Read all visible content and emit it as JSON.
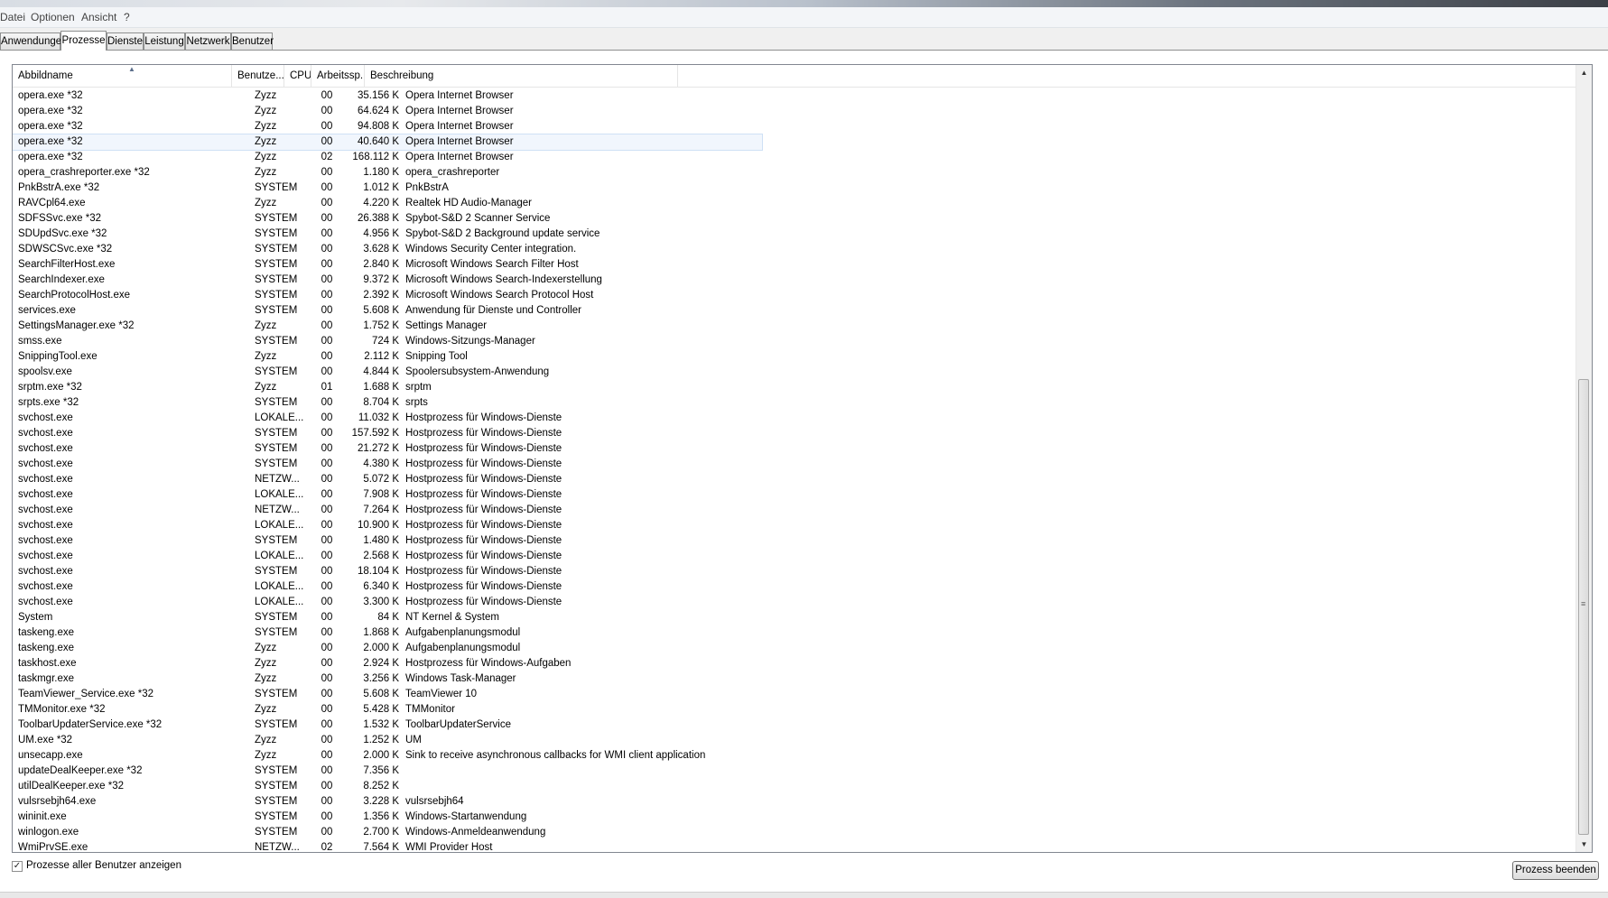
{
  "menu": [
    "Datei",
    "Optionen",
    "Ansicht",
    "?"
  ],
  "tabs": [
    "Anwendungen",
    "Prozesse",
    "Dienste",
    "Leistung",
    "Netzwerk",
    "Benutzer"
  ],
  "active_tab": "Prozesse",
  "columns": [
    "Abbildname",
    "Benutze...",
    "CPU",
    "Arbeitssp...",
    "Beschreibung"
  ],
  "processes": [
    [
      "opera.exe *32",
      "Zyzz",
      "00",
      "35.156 K",
      "Opera Internet Browser"
    ],
    [
      "opera.exe *32",
      "Zyzz",
      "00",
      "64.624 K",
      "Opera Internet Browser"
    ],
    [
      "opera.exe *32",
      "Zyzz",
      "00",
      "94.808 K",
      "Opera Internet Browser"
    ],
    [
      "opera.exe *32",
      "Zyzz",
      "00",
      "40.640 K",
      "Opera Internet Browser"
    ],
    [
      "opera.exe *32",
      "Zyzz",
      "02",
      "168.112 K",
      "Opera Internet Browser"
    ],
    [
      "opera_crashreporter.exe *32",
      "Zyzz",
      "00",
      "1.180 K",
      "opera_crashreporter"
    ],
    [
      "PnkBstrA.exe *32",
      "SYSTEM",
      "00",
      "1.012 K",
      "PnkBstrA"
    ],
    [
      "RAVCpl64.exe",
      "Zyzz",
      "00",
      "4.220 K",
      "Realtek HD Audio-Manager"
    ],
    [
      "SDFSSvc.exe *32",
      "SYSTEM",
      "00",
      "26.388 K",
      "Spybot-S&D 2 Scanner Service"
    ],
    [
      "SDUpdSvc.exe *32",
      "SYSTEM",
      "00",
      "4.956 K",
      "Spybot-S&D 2 Background update service"
    ],
    [
      "SDWSCSvc.exe *32",
      "SYSTEM",
      "00",
      "3.628 K",
      "Windows Security Center integration."
    ],
    [
      "SearchFilterHost.exe",
      "SYSTEM",
      "00",
      "2.840 K",
      "Microsoft Windows Search Filter Host"
    ],
    [
      "SearchIndexer.exe",
      "SYSTEM",
      "00",
      "9.372 K",
      "Microsoft Windows Search-Indexerstellung"
    ],
    [
      "SearchProtocolHost.exe",
      "SYSTEM",
      "00",
      "2.392 K",
      "Microsoft Windows Search Protocol Host"
    ],
    [
      "services.exe",
      "SYSTEM",
      "00",
      "5.608 K",
      "Anwendung für Dienste und Controller"
    ],
    [
      "SettingsManager.exe *32",
      "Zyzz",
      "00",
      "1.752 K",
      "Settings Manager"
    ],
    [
      "smss.exe",
      "SYSTEM",
      "00",
      "724 K",
      "Windows-Sitzungs-Manager"
    ],
    [
      "SnippingTool.exe",
      "Zyzz",
      "00",
      "2.112 K",
      "Snipping Tool"
    ],
    [
      "spoolsv.exe",
      "SYSTEM",
      "00",
      "4.844 K",
      "Spoolersubsystem-Anwendung"
    ],
    [
      "srptm.exe *32",
      "Zyzz",
      "01",
      "1.688 K",
      "srptm"
    ],
    [
      "srpts.exe *32",
      "SYSTEM",
      "00",
      "8.704 K",
      "srpts"
    ],
    [
      "svchost.exe",
      "LOKALE...",
      "00",
      "11.032 K",
      "Hostprozess für Windows-Dienste"
    ],
    [
      "svchost.exe",
      "SYSTEM",
      "00",
      "157.592 K",
      "Hostprozess für Windows-Dienste"
    ],
    [
      "svchost.exe",
      "SYSTEM",
      "00",
      "21.272 K",
      "Hostprozess für Windows-Dienste"
    ],
    [
      "svchost.exe",
      "SYSTEM",
      "00",
      "4.380 K",
      "Hostprozess für Windows-Dienste"
    ],
    [
      "svchost.exe",
      "NETZW...",
      "00",
      "5.072 K",
      "Hostprozess für Windows-Dienste"
    ],
    [
      "svchost.exe",
      "LOKALE...",
      "00",
      "7.908 K",
      "Hostprozess für Windows-Dienste"
    ],
    [
      "svchost.exe",
      "NETZW...",
      "00",
      "7.264 K",
      "Hostprozess für Windows-Dienste"
    ],
    [
      "svchost.exe",
      "LOKALE...",
      "00",
      "10.900 K",
      "Hostprozess für Windows-Dienste"
    ],
    [
      "svchost.exe",
      "SYSTEM",
      "00",
      "1.480 K",
      "Hostprozess für Windows-Dienste"
    ],
    [
      "svchost.exe",
      "LOKALE...",
      "00",
      "2.568 K",
      "Hostprozess für Windows-Dienste"
    ],
    [
      "svchost.exe",
      "SYSTEM",
      "00",
      "18.104 K",
      "Hostprozess für Windows-Dienste"
    ],
    [
      "svchost.exe",
      "LOKALE...",
      "00",
      "6.340 K",
      "Hostprozess für Windows-Dienste"
    ],
    [
      "svchost.exe",
      "LOKALE...",
      "00",
      "3.300 K",
      "Hostprozess für Windows-Dienste"
    ],
    [
      "System",
      "SYSTEM",
      "00",
      "84 K",
      "NT Kernel & System"
    ],
    [
      "taskeng.exe",
      "SYSTEM",
      "00",
      "1.868 K",
      "Aufgabenplanungsmodul"
    ],
    [
      "taskeng.exe",
      "Zyzz",
      "00",
      "2.000 K",
      "Aufgabenplanungsmodul"
    ],
    [
      "taskhost.exe",
      "Zyzz",
      "00",
      "2.924 K",
      "Hostprozess für Windows-Aufgaben"
    ],
    [
      "taskmgr.exe",
      "Zyzz",
      "00",
      "3.256 K",
      "Windows Task-Manager"
    ],
    [
      "TeamViewer_Service.exe *32",
      "SYSTEM",
      "00",
      "5.608 K",
      "TeamViewer 10"
    ],
    [
      "TMMonitor.exe *32",
      "Zyzz",
      "00",
      "5.428 K",
      "TMMonitor"
    ],
    [
      "ToolbarUpdaterService.exe *32",
      "SYSTEM",
      "00",
      "1.532 K",
      "ToolbarUpdaterService"
    ],
    [
      "UM.exe *32",
      "Zyzz",
      "00",
      "1.252 K",
      "UM"
    ],
    [
      "unsecapp.exe",
      "Zyzz",
      "00",
      "2.000 K",
      "Sink to receive asynchronous callbacks for WMI client application"
    ],
    [
      "updateDealKeeper.exe *32",
      "SYSTEM",
      "00",
      "7.356 K",
      ""
    ],
    [
      "utilDealKeeper.exe *32",
      "SYSTEM",
      "00",
      "8.252 K",
      ""
    ],
    [
      "vulsrsebjh64.exe",
      "SYSTEM",
      "00",
      "3.228 K",
      "vulsrsebjh64"
    ],
    [
      "wininit.exe",
      "SYSTEM",
      "00",
      "1.356 K",
      "Windows-Startanwendung"
    ],
    [
      "winlogon.exe",
      "SYSTEM",
      "00",
      "2.700 K",
      "Windows-Anmeldeanwendung"
    ],
    [
      "WmiPrvSE.exe",
      "NETZW...",
      "02",
      "7.564 K",
      "WMI Provider Host"
    ]
  ],
  "selected_row": 3,
  "show_all_users_label": "Prozesse aller Benutzer anzeigen",
  "show_all_users_checked": true,
  "end_process_label": "Prozess beenden"
}
